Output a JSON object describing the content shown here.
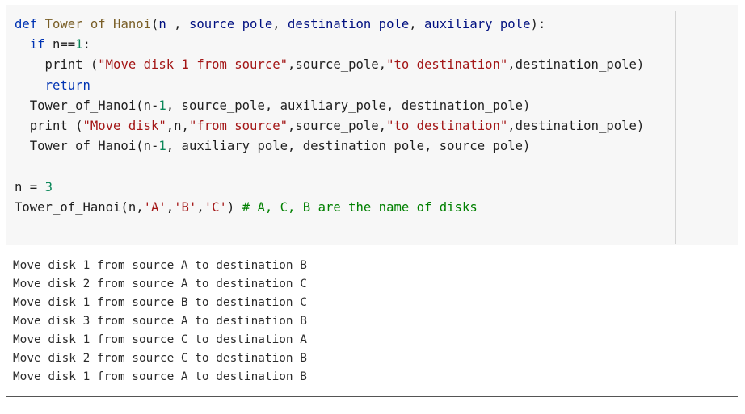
{
  "code_cell": {
    "lines": [
      [
        {
          "t": "def ",
          "c": "kw"
        },
        {
          "t": "Tower_of_Hanoi",
          "c": "fn"
        },
        {
          "t": "(",
          "c": "op"
        },
        {
          "t": "n",
          "c": "var"
        },
        {
          "t": " , ",
          "c": "op"
        },
        {
          "t": "source_pole",
          "c": "var"
        },
        {
          "t": ", ",
          "c": "op"
        },
        {
          "t": "destination_pole",
          "c": "var"
        },
        {
          "t": ", ",
          "c": "op"
        },
        {
          "t": "auxiliary_pole",
          "c": "var"
        },
        {
          "t": "):",
          "c": "op"
        }
      ],
      [
        {
          "t": "  ",
          "c": "op"
        },
        {
          "t": "if",
          "c": "kw"
        },
        {
          "t": " n==",
          "c": "op"
        },
        {
          "t": "1",
          "c": "num"
        },
        {
          "t": ":",
          "c": "op"
        }
      ],
      [
        {
          "t": "    print (",
          "c": "op"
        },
        {
          "t": "\"Move disk 1 from source\"",
          "c": "str"
        },
        {
          "t": ",source_pole,",
          "c": "op"
        },
        {
          "t": "\"to destination\"",
          "c": "str"
        },
        {
          "t": ",destination_pole)",
          "c": "op"
        }
      ],
      [
        {
          "t": "    ",
          "c": "op"
        },
        {
          "t": "return",
          "c": "kw"
        }
      ],
      [
        {
          "t": "  Tower_of_Hanoi(n-",
          "c": "op"
        },
        {
          "t": "1",
          "c": "num"
        },
        {
          "t": ", source_pole, auxiliary_pole, destination_pole)",
          "c": "op"
        }
      ],
      [
        {
          "t": "  print (",
          "c": "op"
        },
        {
          "t": "\"Move disk\"",
          "c": "str"
        },
        {
          "t": ",n,",
          "c": "op"
        },
        {
          "t": "\"from source\"",
          "c": "str"
        },
        {
          "t": ",source_pole,",
          "c": "op"
        },
        {
          "t": "\"to destination\"",
          "c": "str"
        },
        {
          "t": ",destination_pole)",
          "c": "op"
        }
      ],
      [
        {
          "t": "  Tower_of_Hanoi(n-",
          "c": "op"
        },
        {
          "t": "1",
          "c": "num"
        },
        {
          "t": ", auxiliary_pole, destination_pole, source_pole)",
          "c": "op"
        }
      ],
      [
        {
          "t": "",
          "c": "op"
        }
      ],
      [
        {
          "t": "n = ",
          "c": "op"
        },
        {
          "t": "3",
          "c": "num"
        }
      ],
      [
        {
          "t": "Tower_of_Hanoi(n,",
          "c": "op"
        },
        {
          "t": "'A'",
          "c": "str"
        },
        {
          "t": ",",
          "c": "op"
        },
        {
          "t": "'B'",
          "c": "str"
        },
        {
          "t": ",",
          "c": "op"
        },
        {
          "t": "'C'",
          "c": "str"
        },
        {
          "t": ") ",
          "c": "op"
        },
        {
          "t": "# A, C, B are the name of disks",
          "c": "cmt"
        }
      ]
    ]
  },
  "output": {
    "lines": [
      "Move disk 1 from source A to destination B",
      "Move disk 2 from source A to destination C",
      "Move disk 1 from source B to destination C",
      "Move disk 3 from source A to destination B",
      "Move disk 1 from source C to destination A",
      "Move disk 2 from source C to destination B",
      "Move disk 1 from source A to destination B"
    ]
  },
  "colors": {
    "cell_background": "#f7f7f7",
    "keyword": "#0033b3",
    "function": "#795e26",
    "string": "#a31515",
    "number": "#098658",
    "comment": "#008000",
    "output_text": "#2b2b2b"
  }
}
